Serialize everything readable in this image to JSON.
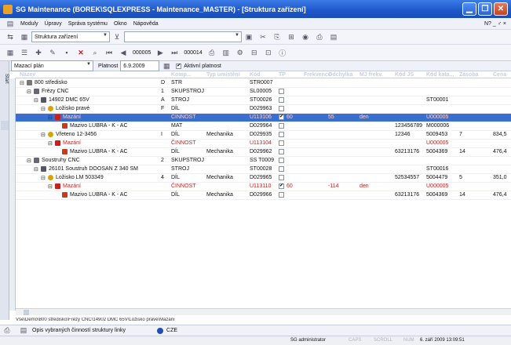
{
  "window": {
    "title": "SG Maintenance (BOREK\\SQLEXPRESS - Maintenance_MASTER) - [Struktura zařízení]"
  },
  "menu": {
    "items": [
      "Moduly",
      "Úpravy",
      "Správa systému",
      "Okno",
      "Nápověda"
    ],
    "right": "N? _ ♂ ×"
  },
  "toolbar1": {
    "combo_value": "Struktura zařízení"
  },
  "toolbar2": {
    "record_current": "000005",
    "record_total": "000014"
  },
  "filter": {
    "plan": "Mazací plán",
    "platnost_label": "Platnost",
    "platnost_value": "6.9.2009",
    "active_label": "Aktivní platnost"
  },
  "columns": [
    "Název",
    "Komp...",
    "Typ umístění",
    "Kód",
    "TP",
    "Frekvence",
    "Odchylka",
    "MJ frekv.",
    "Kód JS",
    "Kód kata...",
    "Zásoba",
    "Cena"
  ],
  "rows": [
    {
      "indent": 0,
      "exp": "⊟",
      "name": "800 středisko",
      "letter": "D",
      "komp": "STR",
      "typ": "",
      "kod": "STR0007",
      "tp": "",
      "freq": "",
      "odch": "",
      "mj": "",
      "kodjs": "",
      "kat": "",
      "zas": "",
      "cena": "",
      "red": false
    },
    {
      "indent": 1,
      "exp": "⊟",
      "name": "Frézy CNC",
      "letter": "1",
      "komp": "SKUPSTROJ",
      "typ": "",
      "kod": "SL00005",
      "tp": "box",
      "freq": "",
      "odch": "",
      "mj": "",
      "kodjs": "",
      "kat": "",
      "zas": "",
      "cena": "",
      "red": false
    },
    {
      "indent": 2,
      "exp": "⊟",
      "name": "14902 DMC 65V",
      "letter": "A",
      "komp": "STROJ",
      "typ": "",
      "kod": "ST00026",
      "tp": "box",
      "freq": "",
      "odch": "",
      "mj": "",
      "kodjs": "",
      "kat": "ST00001",
      "zas": "",
      "cena": "",
      "red": false
    },
    {
      "indent": 3,
      "exp": "⊟",
      "name": "Ložisko pravé",
      "letter": "F",
      "komp": "DÍL",
      "typ": "",
      "kod": "D029963",
      "tp": "box",
      "freq": "",
      "odch": "",
      "mj": "",
      "kodjs": "",
      "kat": "",
      "zas": "",
      "cena": "",
      "red": false
    },
    {
      "indent": 4,
      "exp": "⊟",
      "name": "Mazání",
      "letter": "",
      "komp": "ČINNOST",
      "typ": "",
      "kod": "U113106",
      "tp": "checked",
      "freq": "60",
      "odch": "55",
      "mj": "den",
      "kodjs": "",
      "kat": "U000005",
      "zas": "",
      "cena": "",
      "red": true
    },
    {
      "indent": 5,
      "exp": "",
      "name": "Mazivo LUBRA - K - AC",
      "letter": "",
      "komp": "MAT",
      "typ": "",
      "kod": "D029964",
      "tp": "box",
      "freq": "",
      "odch": "",
      "mj": "",
      "kodjs": "123456789",
      "kat": "M000006",
      "zas": "",
      "cena": "",
      "red": false
    },
    {
      "indent": 3,
      "exp": "⊟",
      "name": "Vřeteno 12-3456",
      "letter": "I",
      "komp": "DÍL",
      "typ": "Mechanika",
      "kod": "D029935",
      "tp": "box",
      "freq": "",
      "odch": "",
      "mj": "",
      "kodjs": "12346",
      "kat": "5009453",
      "zas": "7",
      "cena": "834,5",
      "red": false
    },
    {
      "indent": 4,
      "exp": "⊟",
      "name": "Mazání",
      "letter": "",
      "komp": "ČINNOST",
      "typ": "",
      "kod": "U113104",
      "tp": "box",
      "freq": "",
      "odch": "",
      "mj": "",
      "kodjs": "",
      "kat": "U000005",
      "zas": "",
      "cena": "",
      "red": true
    },
    {
      "indent": 5,
      "exp": "",
      "name": "Mazivo LUBRA - K - AC",
      "letter": "",
      "komp": "DÍL",
      "typ": "Mechanika",
      "kod": "D029962",
      "tp": "box",
      "freq": "",
      "odch": "",
      "mj": "",
      "kodjs": "63213176",
      "kat": "5004369",
      "zas": "14",
      "cena": "476,4",
      "red": false
    },
    {
      "indent": 1,
      "exp": "⊟",
      "name": "Soustruhy CNC",
      "letter": "2",
      "komp": "SKUPSTROJ",
      "typ": "",
      "kod": "SS T0009",
      "tp": "box",
      "freq": "",
      "odch": "",
      "mj": "",
      "kodjs": "",
      "kat": "",
      "zas": "",
      "cena": "",
      "red": false
    },
    {
      "indent": 2,
      "exp": "⊟",
      "name": "26101 Soustruh DOOSAN Z 340 SM",
      "letter": "",
      "komp": "STROJ",
      "typ": "",
      "kod": "ST00028",
      "tp": "box",
      "freq": "",
      "odch": "",
      "mj": "",
      "kodjs": "",
      "kat": "ST00016",
      "zas": "",
      "cena": "",
      "red": false
    },
    {
      "indent": 3,
      "exp": "⊟",
      "name": "Ložisko LM 503349",
      "letter": "4",
      "komp": "DÍL",
      "typ": "Mechanika",
      "kod": "D029965",
      "tp": "box",
      "freq": "",
      "odch": "",
      "mj": "",
      "kodjs": "52534557",
      "kat": "5004479",
      "zas": "5",
      "cena": "351,0",
      "red": false
    },
    {
      "indent": 4,
      "exp": "⊟",
      "name": "Mazání",
      "letter": "",
      "komp": "ČINNOST",
      "typ": "",
      "kod": "U113110",
      "tp": "checked",
      "freq": "60",
      "odch": "-114",
      "mj": "den",
      "kodjs": "",
      "kat": "U000005",
      "zas": "",
      "cena": "",
      "red": true
    },
    {
      "indent": 5,
      "exp": "",
      "name": "Mazivo LUBRA - K - AC",
      "letter": "",
      "komp": "DÍL",
      "typ": "Mechanika",
      "kod": "D029966",
      "tp": "box",
      "freq": "",
      "odch": "",
      "mj": "",
      "kodjs": "63213176",
      "kat": "5004369",
      "zas": "14",
      "cena": "476,4",
      "red": false
    }
  ],
  "selected_row": 4,
  "path": "Vše\\Demo\\800 středisko\\Frézy CNC\\14902 DMC 65V\\Ložisko pravé\\Mazání",
  "taskbar": {
    "item1": "Opis vybraných činností struktury linky",
    "item2": "CZE"
  },
  "status": {
    "user": "SG administrator",
    "caps": "CAPS",
    "scroll": "SCROLL",
    "num": "NUM",
    "datetime": "6. září 2009 13:09:51"
  }
}
